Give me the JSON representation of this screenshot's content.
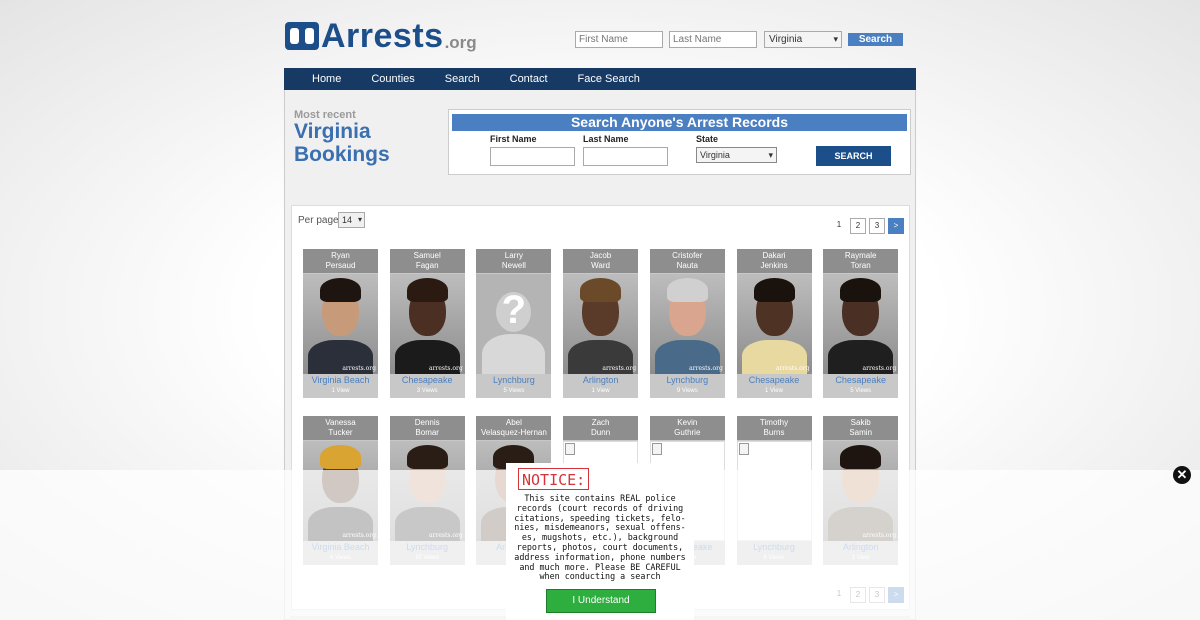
{
  "header": {
    "logo_text": "Arrests",
    "logo_tld": ".org",
    "first_name_placeholder": "First Name",
    "last_name_placeholder": "Last Name",
    "state_selected": "Virginia",
    "search_label": "Search"
  },
  "nav": {
    "items": [
      {
        "label": "Home"
      },
      {
        "label": "Counties"
      },
      {
        "label": "Search"
      },
      {
        "label": "Contact"
      },
      {
        "label": "Face Search"
      }
    ]
  },
  "page": {
    "most_recent": "Most recent",
    "state_title": "Virginia Bookings"
  },
  "search_box": {
    "heading": "Search Anyone's Arrest Records",
    "first_name_label": "First Name",
    "last_name_label": "Last Name",
    "state_label": "State",
    "state_selected": "Virginia",
    "button_label": "SEARCH"
  },
  "results": {
    "per_page_label": "Per page",
    "per_page_value": "14",
    "pagination": [
      "1",
      "2",
      "3",
      ">"
    ],
    "bookings": [
      {
        "first": "Ryan",
        "last": "Persaud",
        "city": "Virginia Beach",
        "views": "1 View",
        "photo": "photo",
        "skin": "#c79b7a",
        "hair": "#1e1410",
        "shirt": "#2b2f3a"
      },
      {
        "first": "Samuel",
        "last": "Fagan",
        "city": "Chesapeake",
        "views": "3 Views",
        "photo": "photo",
        "skin": "#4a2f22",
        "hair": "#2a1a12",
        "shirt": "#1b1b1b"
      },
      {
        "first": "Larry",
        "last": "Newell",
        "city": "Lynchburg",
        "views": "5 Views",
        "photo": "placeholder"
      },
      {
        "first": "Jacob",
        "last": "Ward",
        "city": "Arlington",
        "views": "1 View",
        "photo": "photo",
        "skin": "#5a3a28",
        "hair": "#6b4a2a",
        "shirt": "#3a3a3a"
      },
      {
        "first": "Cristofer",
        "last": "Nauta",
        "city": "Lynchburg",
        "views": "9 Views",
        "photo": "photo",
        "skin": "#d9a58e",
        "hair": "#d0d0d0",
        "shirt": "#4a6a8a"
      },
      {
        "first": "Dakari",
        "last": "Jenkins",
        "city": "Chesapeake",
        "views": "1 View",
        "photo": "photo",
        "skin": "#4e3224",
        "hair": "#1a120c",
        "shirt": "#e8d9a0"
      },
      {
        "first": "Raymale",
        "last": "Toran",
        "city": "Chesapeake",
        "views": "5 Views",
        "photo": "photo",
        "skin": "#4a3024",
        "hair": "#1a120c",
        "shirt": "#1f1f1f"
      },
      {
        "first": "Vanessa",
        "last": "Tucker",
        "city": "Virginia Beach",
        "views": "6 Views",
        "photo": "photo",
        "skin": "#5a3a28",
        "hair": "#d9a431",
        "shirt": "#2a2a2a"
      },
      {
        "first": "Dennis",
        "last": "Bomar",
        "city": "Lynchburg",
        "views": "10 Views",
        "photo": "photo",
        "skin": "#c89c80",
        "hair": "#2a1d16",
        "shirt": "#3b3b3b"
      },
      {
        "first": "Abel",
        "last": "Velasquez-Hernan",
        "city": "Arlington",
        "views": "1 View",
        "photo": "photo",
        "skin": "#a9785a",
        "hair": "#2a1d16",
        "shirt": "#5a4a3a"
      },
      {
        "first": "Zach",
        "last": "Dunn",
        "city": "Chesapeake",
        "views": "1 View",
        "photo": "broken"
      },
      {
        "first": "Kevin",
        "last": "Guthrie",
        "city": "Chesapeake",
        "views": "1 View",
        "photo": "broken"
      },
      {
        "first": "Timothy",
        "last": "Burns",
        "city": "Lynchburg",
        "views": "6 Views",
        "photo": "broken"
      },
      {
        "first": "Sakib",
        "last": "Samin",
        "city": "Arlington",
        "views": "1 View",
        "photo": "photo",
        "skin": "#c89270",
        "hair": "#1e1410",
        "shirt": "#6a5a4a"
      }
    ]
  },
  "notice": {
    "title": "NOTICE:",
    "body": "This site contains REAL police\nrecords (court records of driving\ncitations, speeding tickets, felo-\nnies, misdemeanors, sexual offens-\nes, mugshots, etc.), background\nreports, photos, court documents,\naddress information, phone numbers\nand much more. Please BE CAREFUL\nwhen conducting a search",
    "button_label": "I Understand"
  },
  "watermark": "arrests.org",
  "colors": {
    "brand": "#1c4f8a",
    "nav_bg": "#173a65",
    "accent": "#4a7fc1",
    "notice_red": "#d4343a",
    "understand_green": "#2eae3e"
  },
  "icons": {
    "close": "close-icon",
    "dropdown": "chevron-down-icon"
  }
}
